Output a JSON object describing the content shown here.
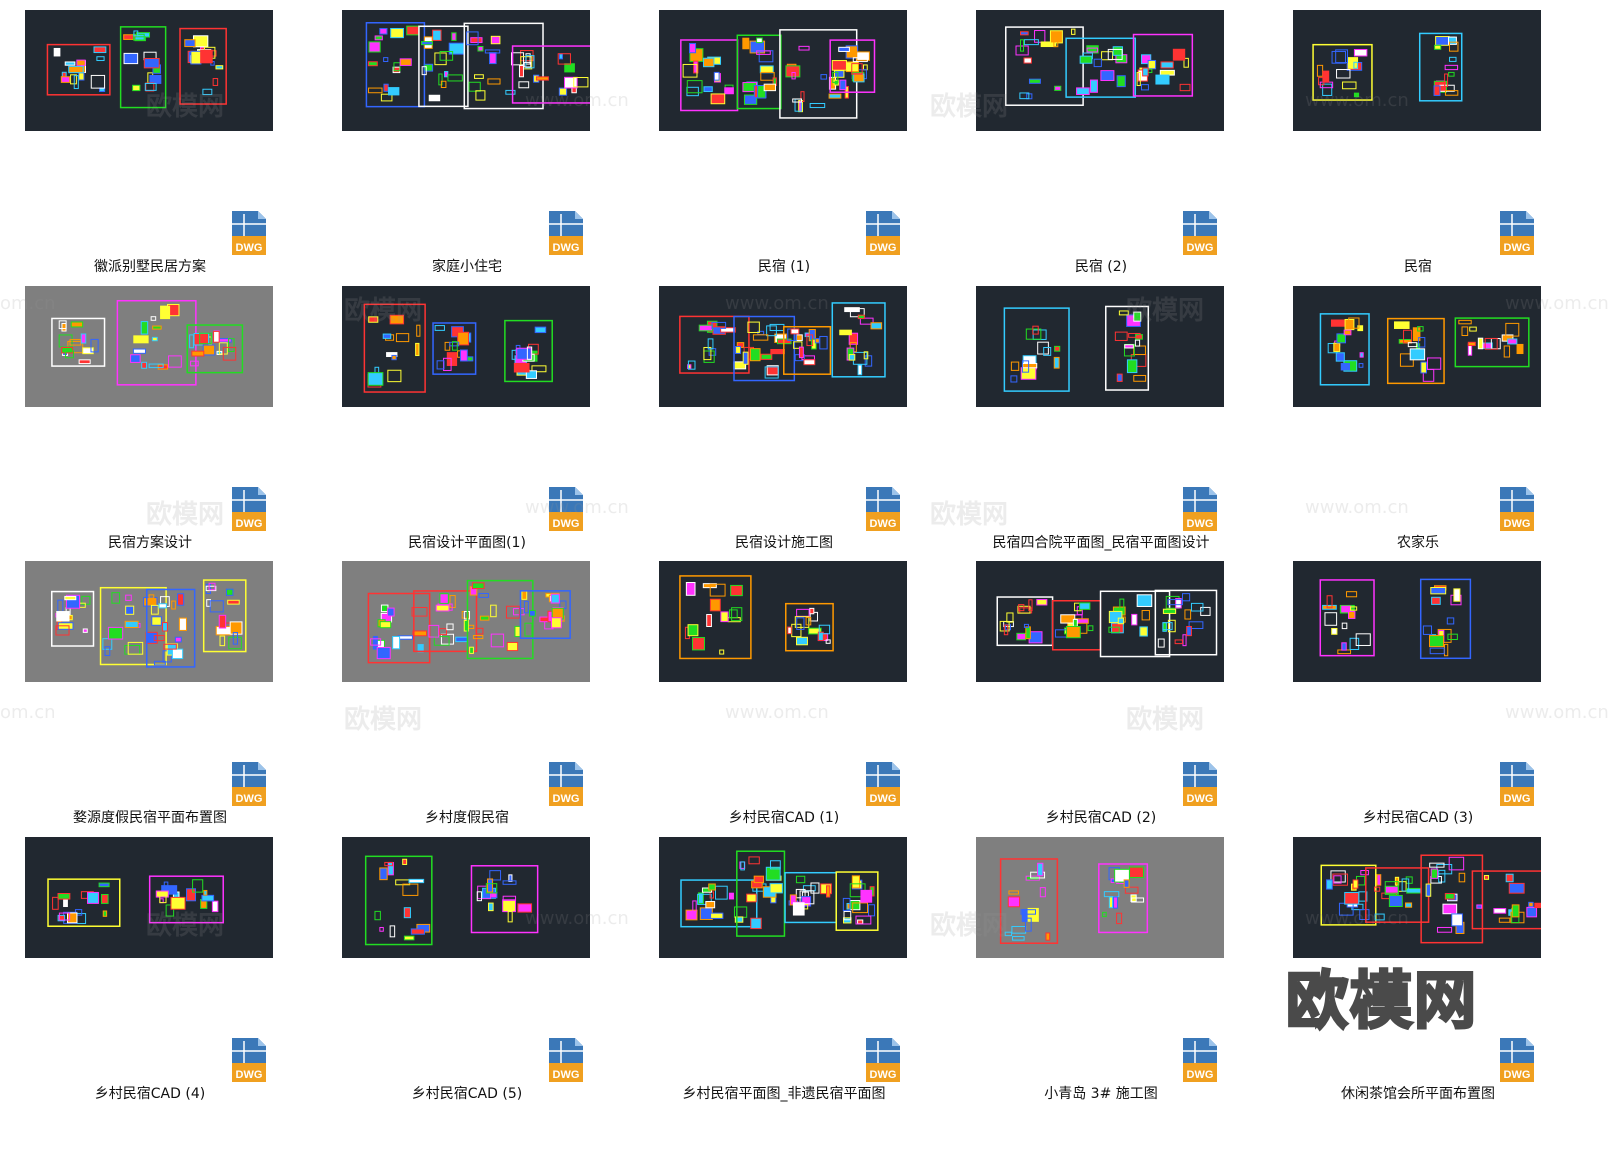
{
  "grid": {
    "items": [
      {
        "label": "徽派别墅民居方案",
        "icon": "dwg-file-icon",
        "bg": "dark"
      },
      {
        "label": "家庭小住宅",
        "icon": "dwg-file-icon",
        "bg": "dark"
      },
      {
        "label": "民宿 (1)",
        "icon": "dwg-file-icon",
        "bg": "dark"
      },
      {
        "label": "民宿 (2)",
        "icon": "dwg-file-icon",
        "bg": "dark"
      },
      {
        "label": "民宿",
        "icon": "dwg-file-icon",
        "bg": "dark"
      },
      {
        "label": "民宿方案设计",
        "icon": "dwg-file-icon",
        "bg": "gray"
      },
      {
        "label": "民宿设计平面图(1)",
        "icon": "dwg-file-icon",
        "bg": "dark"
      },
      {
        "label": "民宿设计施工图",
        "icon": "dwg-file-icon",
        "bg": "dark"
      },
      {
        "label": "民宿四合院平面图_民宿平面图设计",
        "icon": "dwg-file-icon",
        "bg": "dark"
      },
      {
        "label": "农家乐",
        "icon": "dwg-file-icon",
        "bg": "dark"
      },
      {
        "label": "婺源度假民宿平面布置图",
        "icon": "dwg-file-icon",
        "bg": "gray"
      },
      {
        "label": "乡村度假民宿",
        "icon": "dwg-file-icon",
        "bg": "gray"
      },
      {
        "label": "乡村民宿CAD (1)",
        "icon": "dwg-file-icon",
        "bg": "dark"
      },
      {
        "label": "乡村民宿CAD (2)",
        "icon": "dwg-file-icon",
        "bg": "dark"
      },
      {
        "label": "乡村民宿CAD (3)",
        "icon": "dwg-file-icon",
        "bg": "dark"
      },
      {
        "label": "乡村民宿CAD (4)",
        "icon": "dwg-file-icon",
        "bg": "dark"
      },
      {
        "label": "乡村民宿CAD (5)",
        "icon": "dwg-file-icon",
        "bg": "dark"
      },
      {
        "label": "乡村民宿平面图_非遗民宿平面图",
        "icon": "dwg-file-icon",
        "bg": "dark"
      },
      {
        "label": "小青岛 3# 施工图",
        "icon": "dwg-file-icon",
        "bg": "gray"
      },
      {
        "label": "休闲茶馆会所平面布置图",
        "icon": "dwg-file-icon",
        "bg": "dark"
      }
    ],
    "badge_text": "DWG"
  },
  "watermark": {
    "brand": "欧模网",
    "url": "www.om.cn",
    "url_fragment": "om.cn"
  },
  "colors": {
    "thumb_dark": "#212830",
    "thumb_gray": "#7f7f7f",
    "dwg_blue": "#3b78b8",
    "dwg_orange": "#f0a020"
  }
}
